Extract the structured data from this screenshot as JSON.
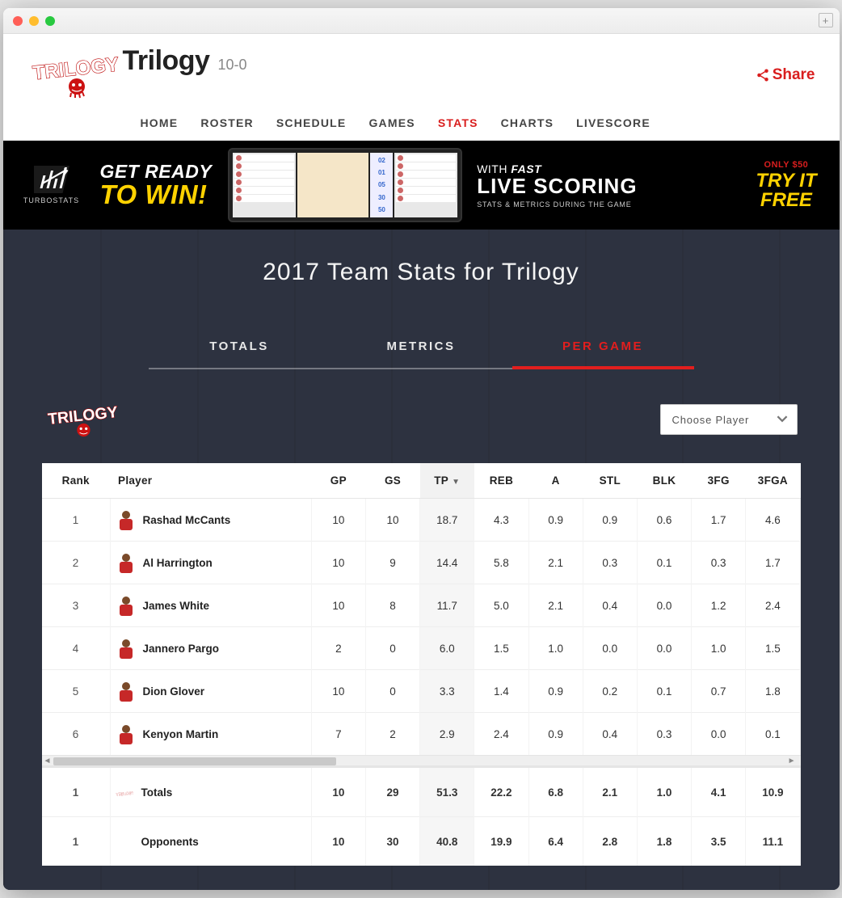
{
  "team": {
    "name": "Trilogy",
    "record": "10-0"
  },
  "share_label": "Share",
  "nav": {
    "items": [
      "HOME",
      "ROSTER",
      "SCHEDULE",
      "GAMES",
      "STATS",
      "CHARTS",
      "LIVESCORE"
    ],
    "active_index": 4
  },
  "banner": {
    "brand": "TURBOSTATS",
    "left_line1": "GET READY",
    "left_line2": "TO WIN!",
    "mid_line1_prefix": "WITH ",
    "mid_line1_em": "FAST",
    "mid_line2": "LIVE SCORING",
    "mid_line3": "STATS & METRICS DURING THE GAME",
    "cta_line1": "ONLY $50",
    "cta_line2a": "TRY IT",
    "cta_line2b": "FREE"
  },
  "page_title": "2017 Team Stats for Trilogy",
  "tabs": {
    "items": [
      "TOTALS",
      "METRICS",
      "PER GAME"
    ],
    "active_index": 2
  },
  "player_select": {
    "placeholder": "Choose Player"
  },
  "table": {
    "columns": [
      "Rank",
      "Player",
      "GP",
      "GS",
      "TP",
      "REB",
      "A",
      "STL",
      "BLK",
      "3FG",
      "3FGA"
    ],
    "sorted_col_index": 4,
    "sort_dir": "desc",
    "rows": [
      {
        "rank": "1",
        "player": "Rashad McCants",
        "cells": [
          "10",
          "10",
          "18.7",
          "4.3",
          "0.9",
          "0.9",
          "0.6",
          "1.7",
          "4.6"
        ]
      },
      {
        "rank": "2",
        "player": "Al Harrington",
        "cells": [
          "10",
          "9",
          "14.4",
          "5.8",
          "2.1",
          "0.3",
          "0.1",
          "0.3",
          "1.7"
        ]
      },
      {
        "rank": "3",
        "player": "James White",
        "cells": [
          "10",
          "8",
          "11.7",
          "5.0",
          "2.1",
          "0.4",
          "0.0",
          "1.2",
          "2.4"
        ]
      },
      {
        "rank": "4",
        "player": "Jannero Pargo",
        "cells": [
          "2",
          "0",
          "6.0",
          "1.5",
          "1.0",
          "0.0",
          "0.0",
          "1.0",
          "1.5"
        ]
      },
      {
        "rank": "5",
        "player": "Dion Glover",
        "cells": [
          "10",
          "0",
          "3.3",
          "1.4",
          "0.9",
          "0.2",
          "0.1",
          "0.7",
          "1.8"
        ]
      },
      {
        "rank": "6",
        "player": "Kenyon Martin",
        "cells": [
          "7",
          "2",
          "2.9",
          "2.4",
          "0.9",
          "0.4",
          "0.3",
          "0.0",
          "0.1"
        ]
      }
    ],
    "summary": [
      {
        "rank": "1",
        "label": "Totals",
        "logo": true,
        "cells": [
          "10",
          "29",
          "51.3",
          "22.2",
          "6.8",
          "2.1",
          "1.0",
          "4.1",
          "10.9"
        ]
      },
      {
        "rank": "1",
        "label": "Opponents",
        "logo": false,
        "cells": [
          "10",
          "30",
          "40.8",
          "19.9",
          "6.4",
          "2.8",
          "1.8",
          "3.5",
          "11.1"
        ]
      }
    ]
  }
}
